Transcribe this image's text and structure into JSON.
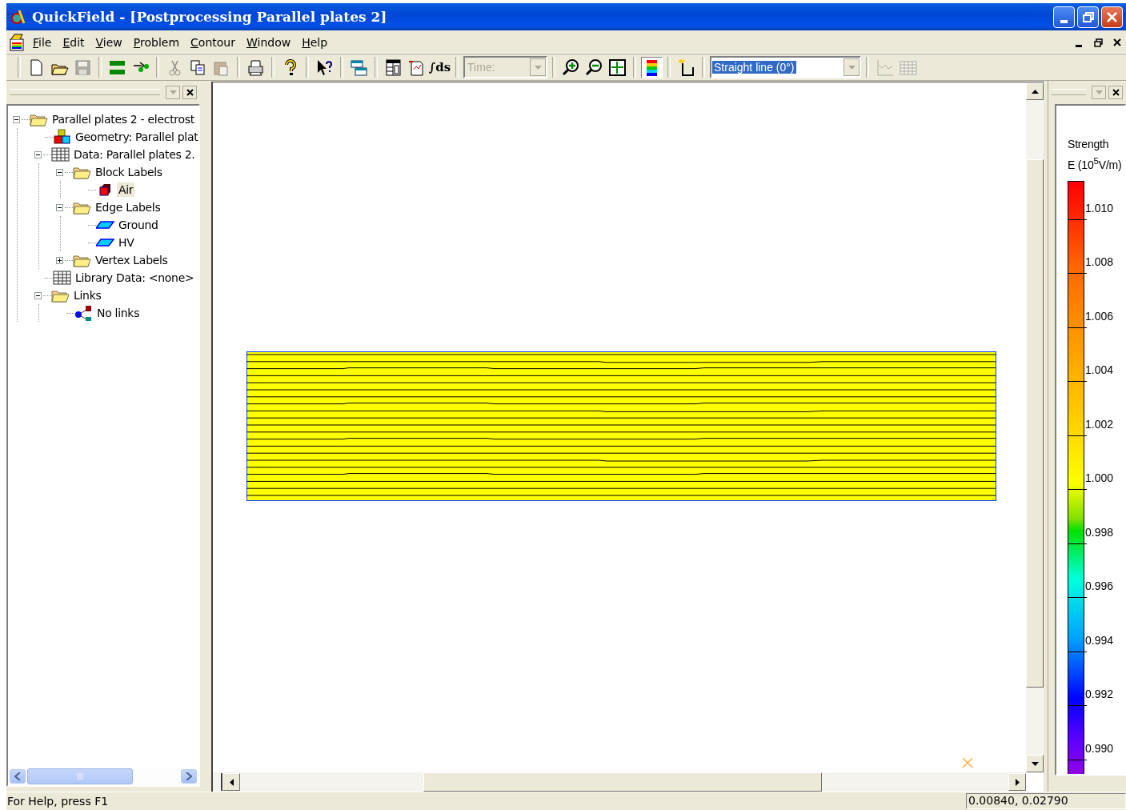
{
  "window": {
    "title": "QuickField - [Postprocessing Parallel plates 2]"
  },
  "menu": [
    "File",
    "Edit",
    "View",
    "Problem",
    "Contour",
    "Window",
    "Help"
  ],
  "toolbar": [
    {
      "kind": "button",
      "disabled": false,
      "pressed": false
    },
    {
      "kind": "button",
      "disabled": false,
      "pressed": false
    },
    {
      "kind": "button",
      "disabled": true,
      "pressed": false
    },
    {
      "kind": "separator"
    },
    {
      "kind": "button",
      "disabled": false,
      "pressed": false
    },
    {
      "kind": "button",
      "disabled": false,
      "pressed": false
    },
    {
      "kind": "separator"
    },
    {
      "kind": "button",
      "disabled": true,
      "pressed": false
    },
    {
      "kind": "button",
      "disabled": false,
      "pressed": false
    },
    {
      "kind": "button",
      "disabled": true,
      "pressed": false
    },
    {
      "kind": "separator"
    },
    {
      "kind": "button",
      "disabled": false,
      "pressed": false
    },
    {
      "kind": "separator"
    },
    {
      "kind": "button",
      "disabled": false,
      "pressed": false
    },
    {
      "kind": "separator"
    },
    {
      "kind": "button",
      "disabled": false,
      "pressed": false
    },
    {
      "kind": "separator"
    },
    {
      "kind": "button",
      "disabled": false,
      "pressed": false
    },
    {
      "kind": "separator"
    },
    {
      "kind": "button",
      "disabled": false,
      "pressed": false
    },
    {
      "kind": "button",
      "disabled": false,
      "pressed": false
    },
    {
      "kind": "button",
      "label": "∫ds",
      "disabled": false,
      "pressed": false
    },
    {
      "kind": "separator"
    },
    {
      "kind": "combo",
      "placeholder": "Time:",
      "disabled": true,
      "highlighted": false
    },
    {
      "kind": "separator"
    },
    {
      "kind": "button",
      "disabled": false,
      "pressed": false
    },
    {
      "kind": "button",
      "disabled": false,
      "pressed": false
    },
    {
      "kind": "button",
      "disabled": false,
      "pressed": false
    },
    {
      "kind": "separator"
    },
    {
      "kind": "button",
      "disabled": false,
      "pressed": true
    },
    {
      "kind": "separator"
    },
    {
      "kind": "button",
      "disabled": false,
      "pressed": false
    },
    {
      "kind": "separator"
    },
    {
      "kind": "combo",
      "value": "Straight line (0°)",
      "disabled": false,
      "highlighted": true
    },
    {
      "kind": "separator"
    },
    {
      "kind": "button",
      "disabled": true,
      "pressed": false
    },
    {
      "kind": "button",
      "disabled": true,
      "pressed": false
    }
  ],
  "tree": [
    {
      "label": "Parallel plates 2 - electrost",
      "kind": "folder",
      "expanded": true,
      "selected": false,
      "children": [
        {
          "label": "Geometry: Parallel plat",
          "kind": "geometry",
          "selected": false
        },
        {
          "label": "Data: Parallel plates 2.",
          "kind": "table",
          "expanded": true,
          "selected": false,
          "children": [
            {
              "label": "Block Labels",
              "kind": "folder",
              "expanded": true,
              "selected": false,
              "children": [
                {
                  "label": "Air",
                  "kind": "block",
                  "selected": true
                }
              ]
            },
            {
              "label": "Edge Labels",
              "kind": "folder",
              "expanded": true,
              "selected": false,
              "children": [
                {
                  "label": "Ground",
                  "kind": "edge",
                  "selected": false
                },
                {
                  "label": "HV",
                  "kind": "edge",
                  "selected": false
                }
              ]
            },
            {
              "label": "Vertex Labels",
              "kind": "folder",
              "expanded": false,
              "selected": false
            }
          ]
        },
        {
          "label": "Library Data: <none>",
          "kind": "table",
          "selected": false
        },
        {
          "label": "Links",
          "kind": "folder",
          "expanded": true,
          "selected": false,
          "children": [
            {
              "label": "No links",
              "kind": "link",
              "selected": false
            }
          ]
        }
      ]
    }
  ],
  "legend": {
    "title": "Strength",
    "unit": "E (10$^{5}$V/m)",
    "labels": [
      "1.010",
      "1.008",
      "1.006",
      "1.004",
      "1.002",
      "1.000",
      "0.998",
      "0.996",
      "0.994",
      "0.992",
      "0.990"
    ]
  },
  "status_bar": {
    "help": "For Help, press F1",
    "coordinates": "0.00840, 0.02790"
  }
}
